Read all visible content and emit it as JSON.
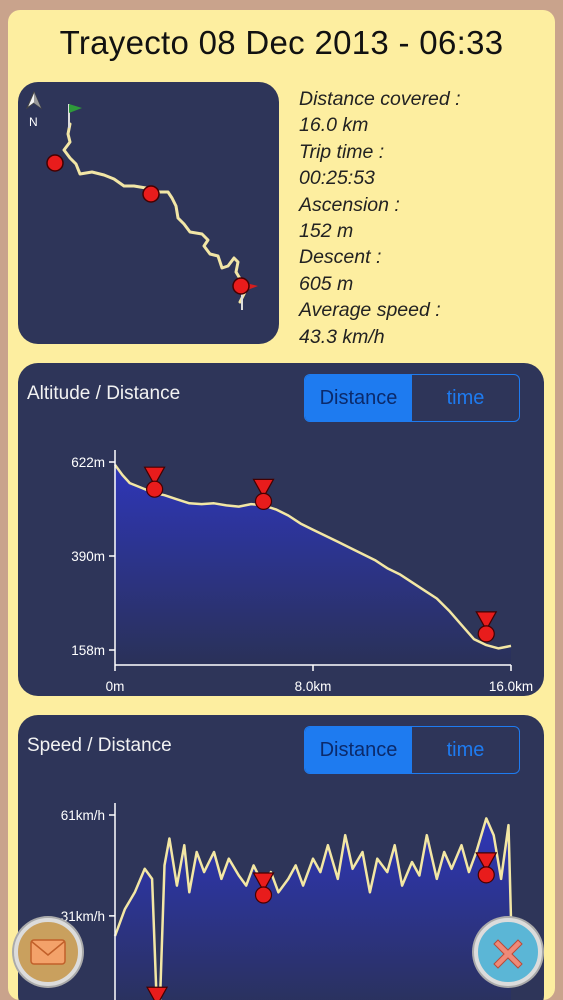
{
  "header": {
    "title": "Trayecto 08 Dec 2013 - 06:33"
  },
  "map": {
    "north_label": "N"
  },
  "stats": {
    "distance_label": "Distance covered :",
    "distance_value": "16.0 km",
    "time_label": "Trip time :",
    "time_value": "00:25:53",
    "ascension_label": "Ascension :",
    "ascension_value": "152 m",
    "descent_label": "Descent :",
    "descent_value": "605 m",
    "speed_label": "Average speed :",
    "speed_value": "43.3 km/h"
  },
  "altitude_panel": {
    "title": "Altitude / Distance",
    "toggle_distance": "Distance",
    "toggle_time": "time"
  },
  "speed_panel": {
    "title": "Speed / Distance",
    "toggle_distance": "Distance",
    "toggle_time": "time"
  },
  "chart_data": [
    {
      "type": "area",
      "title": "Altitude / Distance",
      "x_unit": "km",
      "y_unit": "m",
      "y_ticks": [
        "622m",
        "390m",
        "158m"
      ],
      "y_tick_values": [
        622,
        390,
        158
      ],
      "x_ticks": [
        "0m",
        "8.0km",
        "16.0km"
      ],
      "x_tick_values": [
        0,
        8,
        16
      ],
      "xlim": [
        0,
        16
      ],
      "ylim": [
        158,
        622
      ],
      "x": [
        0,
        0.3,
        0.6,
        1.0,
        1.6,
        2.0,
        2.5,
        3.0,
        3.5,
        4.0,
        4.5,
        5.0,
        5.5,
        6.0,
        6.5,
        7.0,
        7.5,
        8.0,
        8.5,
        9.0,
        9.5,
        10.0,
        10.5,
        11.0,
        11.5,
        12.0,
        12.5,
        13.0,
        13.5,
        14.0,
        14.5,
        15.0,
        15.5,
        16.0
      ],
      "y": [
        615,
        590,
        570,
        560,
        545,
        540,
        530,
        520,
        518,
        520,
        515,
        512,
        518,
        515,
        505,
        490,
        470,
        455,
        440,
        425,
        410,
        395,
        380,
        360,
        345,
        325,
        305,
        285,
        255,
        220,
        185,
        170,
        162,
        168
      ],
      "markers_x": [
        1.6,
        6.0,
        15.0
      ],
      "markers_y": [
        545,
        515,
        188
      ]
    },
    {
      "type": "line",
      "title": "Speed / Distance",
      "y_unit": "km/h",
      "y_ticks": [
        "61km/h",
        "31km/h"
      ],
      "y_tick_values": [
        61,
        31
      ],
      "xlim": [
        0,
        16
      ],
      "ylim": [
        0,
        61
      ],
      "x": [
        0,
        0.4,
        0.8,
        1.2,
        1.5,
        1.7,
        1.8,
        2.0,
        2.2,
        2.5,
        2.8,
        3.0,
        3.3,
        3.6,
        4.0,
        4.3,
        4.6,
        5.0,
        5.3,
        5.6,
        6.0,
        6.3,
        6.6,
        7.0,
        7.3,
        7.6,
        8.0,
        8.3,
        8.6,
        9.0,
        9.3,
        9.6,
        10.0,
        10.3,
        10.6,
        11.0,
        11.3,
        11.6,
        12.0,
        12.3,
        12.6,
        13.0,
        13.3,
        13.6,
        14.0,
        14.3,
        14.6,
        15.0,
        15.3,
        15.6,
        15.9,
        16.0
      ],
      "y": [
        25,
        33,
        38,
        45,
        42,
        2,
        2,
        46,
        54,
        40,
        52,
        38,
        50,
        44,
        50,
        42,
        48,
        43,
        40,
        46,
        40,
        44,
        38,
        42,
        46,
        40,
        48,
        44,
        52,
        42,
        55,
        45,
        50,
        38,
        48,
        44,
        52,
        40,
        47,
        43,
        55,
        42,
        50,
        45,
        52,
        44,
        50,
        60,
        55,
        42,
        58,
        30
      ],
      "markers_x": [
        1.7,
        6.0,
        15.0
      ],
      "markers_y": [
        2,
        36,
        42
      ]
    }
  ]
}
